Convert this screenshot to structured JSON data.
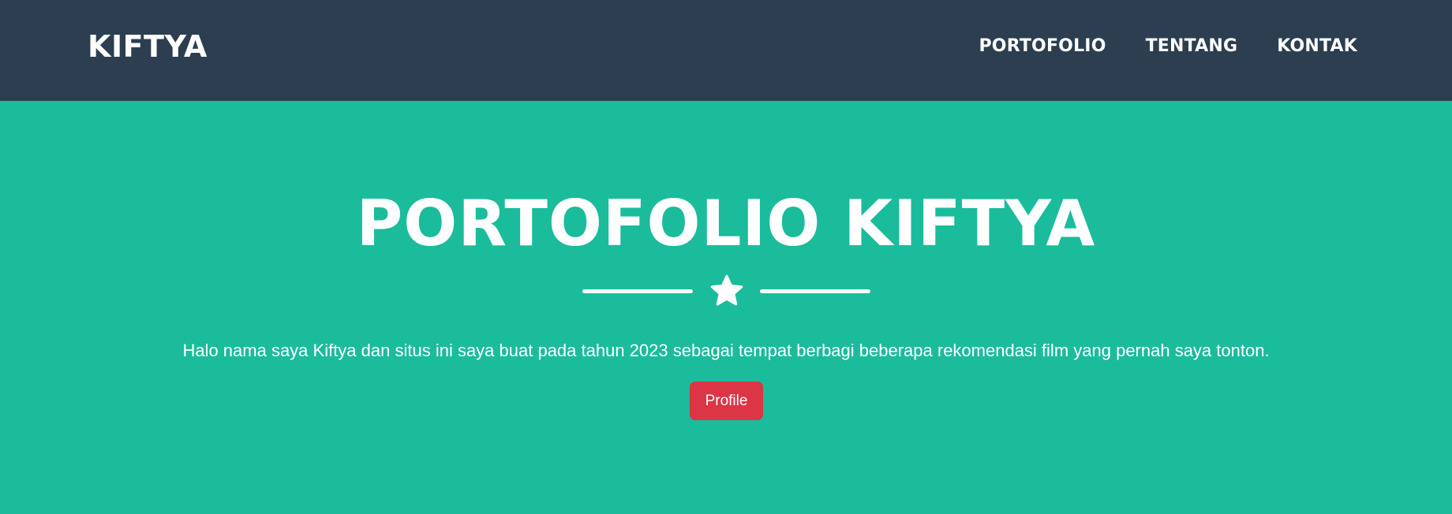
{
  "navbar": {
    "brand": "KIFTYA",
    "links": [
      "PORTOFOLIO",
      "TENTANG",
      "KONTAK"
    ]
  },
  "masthead": {
    "title": "PORTOFOLIO KIFTYA",
    "divider_icon": "star-icon",
    "lead": "Halo nama saya Kiftya dan situs ini saya buat pada tahun 2023 sebagai tempat berbagi beberapa rekomendasi film yang pernah saya tonton.",
    "button_label": "Profile"
  },
  "colors": {
    "navbar_bg": "#2c3e50",
    "masthead_bg": "#1abc9c",
    "button_bg": "#dc3545",
    "text": "#ffffff"
  }
}
